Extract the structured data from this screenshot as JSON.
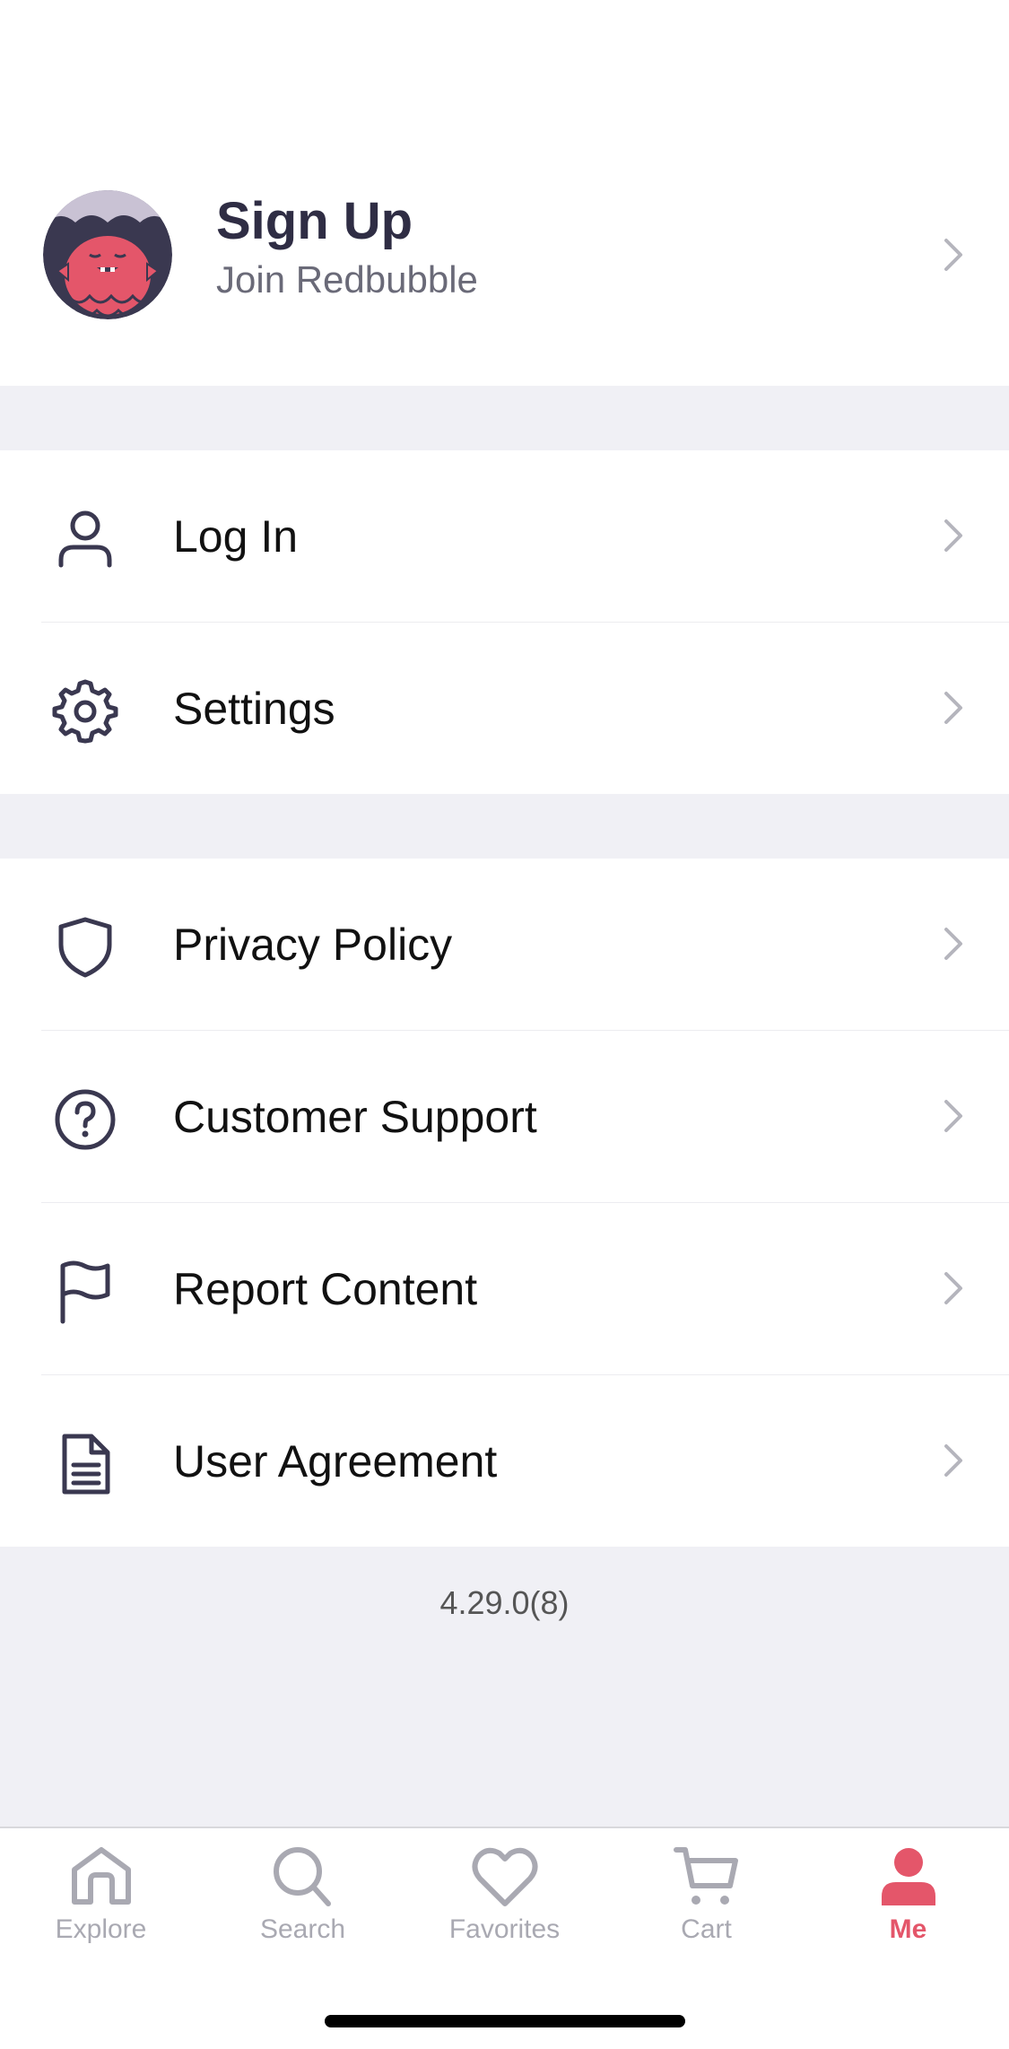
{
  "signup": {
    "title": "Sign Up",
    "subtitle": "Join Redbubble"
  },
  "menu_group_1": [
    {
      "label": "Log In",
      "icon": "person-icon"
    },
    {
      "label": "Settings",
      "icon": "gear-icon"
    }
  ],
  "menu_group_2": [
    {
      "label": "Privacy Policy",
      "icon": "shield-icon"
    },
    {
      "label": "Customer Support",
      "icon": "question-circle-icon"
    },
    {
      "label": "Report Content",
      "icon": "flag-icon"
    },
    {
      "label": "User Agreement",
      "icon": "document-icon"
    }
  ],
  "version": "4.29.0(8)",
  "tabs": [
    {
      "label": "Explore",
      "icon": "home-icon",
      "active": false
    },
    {
      "label": "Search",
      "icon": "search-icon",
      "active": false
    },
    {
      "label": "Favorites",
      "icon": "heart-icon",
      "active": false
    },
    {
      "label": "Cart",
      "icon": "cart-icon",
      "active": false
    },
    {
      "label": "Me",
      "icon": "person-icon",
      "active": true
    }
  ],
  "colors": {
    "accent": "#e4566a",
    "text_dark": "#2f2d44",
    "icon_dark": "#3a3850",
    "inactive_tab": "#a9a9b2",
    "section_gap": "#f0f0f5"
  }
}
